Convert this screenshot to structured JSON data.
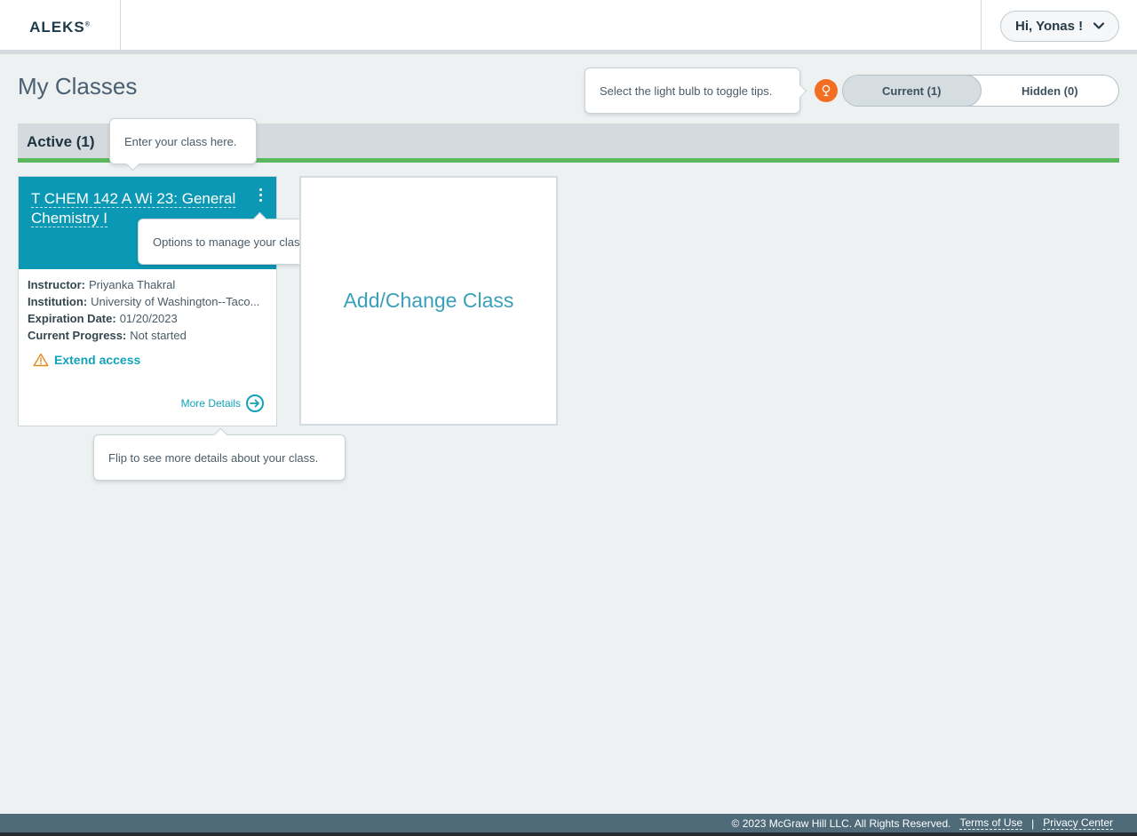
{
  "header": {
    "logo": "ALEKS",
    "user_greeting": "Hi, Yonas !"
  },
  "page": {
    "title": "My Classes"
  },
  "tips": {
    "bulb": "Select the light bulb to toggle tips.",
    "enter_class": "Enter your class here.",
    "options": "Options to manage your class are here.",
    "flip": "Flip to see more details about your class."
  },
  "toggle": {
    "current": "Current (1)",
    "hidden": "Hidden (0)"
  },
  "section": {
    "label": "Active (1)"
  },
  "class_card": {
    "title": "T CHEM 142 A Wi 23: General Chemistry I",
    "instructor_label": "Instructor:",
    "instructor": "Priyanka Thakral",
    "institution_label": "Institution:",
    "institution": "University of Washington--Taco...",
    "expiration_label": "Expiration Date:",
    "expiration": "01/20/2023",
    "progress_label": "Current Progress:",
    "progress": "Not started",
    "extend": "Extend access",
    "more": "More Details"
  },
  "add_card": {
    "label": "Add/Change Class"
  },
  "footer": {
    "copyright": "© 2023 McGraw Hill LLC. All Rights Reserved.",
    "terms": "Terms of Use",
    "separator": "|",
    "privacy": "Privacy Center"
  },
  "colors": {
    "card_header": "#0a98b5",
    "accent": "#13a3b9",
    "bulb": "#f26f21",
    "active_underline": "#5cb85c"
  }
}
